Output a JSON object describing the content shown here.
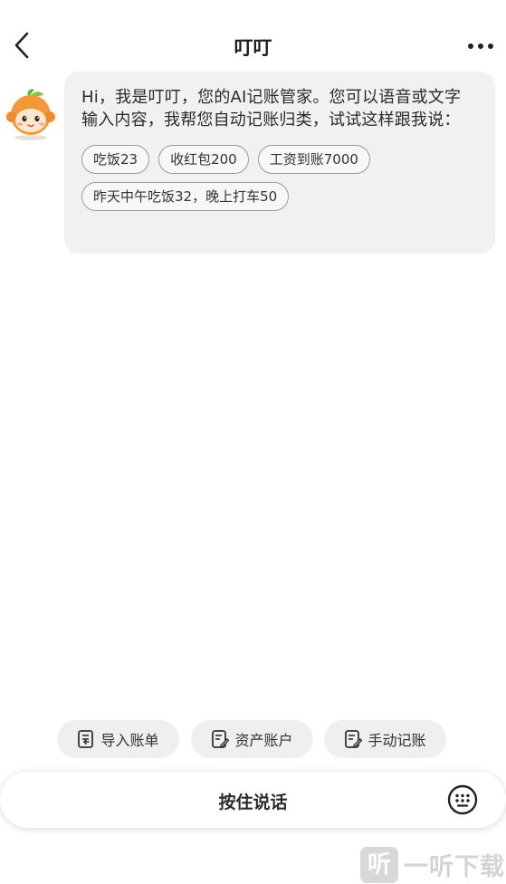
{
  "header": {
    "title": "叮叮",
    "back_icon": "chevron-left-icon",
    "more_icon": "more-horizontal-icon"
  },
  "assistant": {
    "avatar_icon": "orange-mascot-avatar",
    "message": "Hi，我是叮叮，您的AI记账管家。您可以语音或文字输入内容，我帮您自动记账归类，试试这样跟我说：",
    "suggestions": [
      "吃饭23",
      "收红包200",
      "工资到账7000",
      "昨天中午吃饭32，晚上打车50"
    ]
  },
  "quick_actions": [
    {
      "label": "导入账单",
      "icon": "import-bill-icon"
    },
    {
      "label": "资产账户",
      "icon": "asset-account-icon"
    },
    {
      "label": "手动记账",
      "icon": "manual-entry-icon"
    }
  ],
  "input_bar": {
    "press_to_talk": "按住说话",
    "keyboard_icon": "keyboard-icon"
  },
  "watermark": {
    "badge": "听",
    "text": "一听下载"
  },
  "colors": {
    "bubble_bg": "#f1f1f1",
    "chip_border": "#9a9a9a",
    "quick_action_bg": "#efefef",
    "avatar_orange": "#f4993a"
  }
}
